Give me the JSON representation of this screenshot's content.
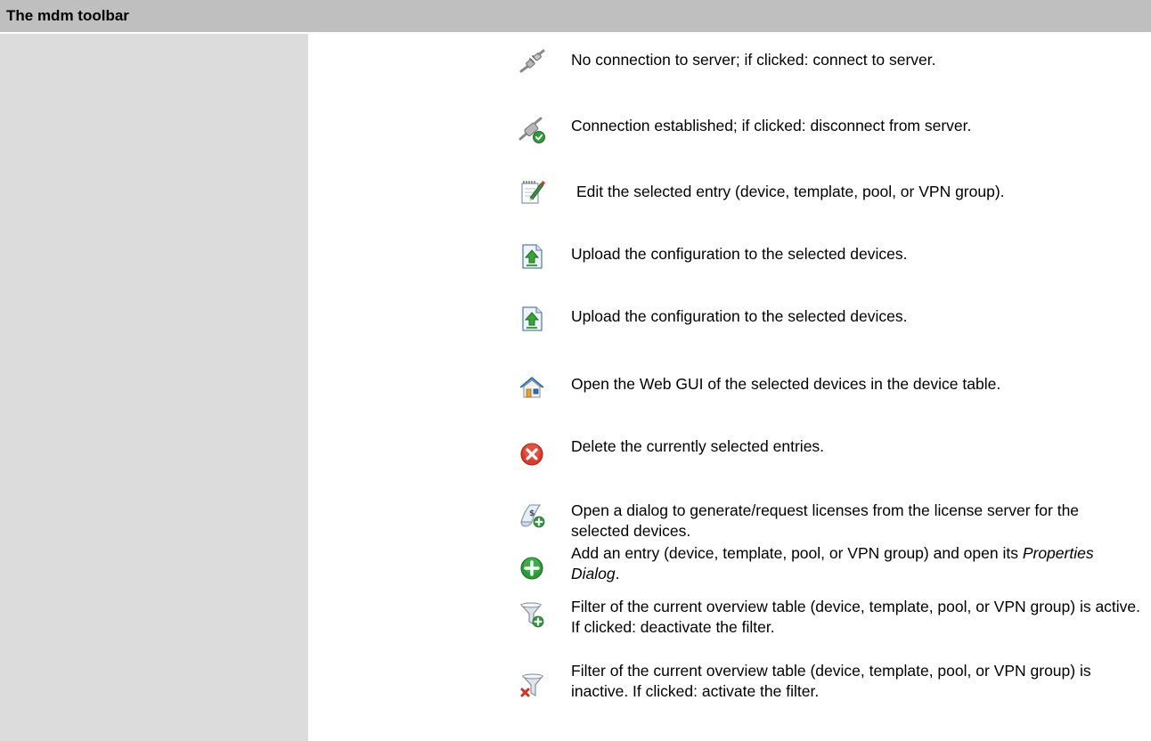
{
  "header": {
    "title": "The mdm toolbar"
  },
  "rows": [
    {
      "icon": "disconnected-plug-icon",
      "text": "No connection to server; if clicked: connect to server."
    },
    {
      "icon": "connected-plug-icon",
      "text": "Connection established; if clicked: disconnect from server."
    },
    {
      "icon": "edit-notepad-icon",
      "text": "Edit the selected entry (device, template, pool, or VPN group)."
    },
    {
      "icon": "upload-document-icon",
      "text": "Upload the configuration to the selected devices."
    },
    {
      "icon": "upload-document-icon",
      "text": "Upload the configuration to the selected devices."
    },
    {
      "icon": "home-icon",
      "text": "Open the Web GUI of the selected devices in the device table."
    },
    {
      "icon": "delete-icon",
      "text": "Delete the currently selected entries."
    },
    {
      "icon": "license-icon",
      "text": "Open a dialog to generate/request licenses from the license server for the selected devices."
    },
    {
      "icon": "add-icon",
      "text_before": "Add an entry (device, template, pool, or VPN group) and open its ",
      "text_italic": "Properties Dialog",
      "text_after": "."
    },
    {
      "icon": "filter-active-icon",
      "text": "Filter of the current overview table (device, template, pool, or VPN group) is active. If clicked: deactivate the filter."
    },
    {
      "icon": "filter-inactive-icon",
      "text": "Filter of the current overview table (device, template, pool, or VPN group) is inactive. If clicked: activate the filter."
    }
  ]
}
